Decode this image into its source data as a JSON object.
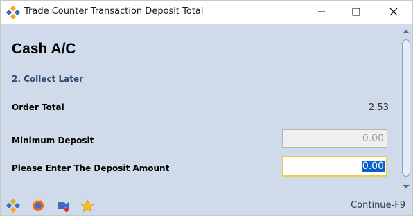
{
  "window": {
    "title": "Trade Counter Transaction Deposit Total"
  },
  "main": {
    "heading": "Cash A/C",
    "subheading": "2. Collect Later",
    "order_total_label": "Order Total",
    "order_total_value": "2.53",
    "minimum_deposit_label": "Minimum Deposit",
    "minimum_deposit_value": "0.00",
    "deposit_prompt_label": "Please Enter The Deposit Amount",
    "deposit_amount_value": "0.00"
  },
  "footer": {
    "icons": [
      "app-logo-icon",
      "browser-icon",
      "recorder-icon",
      "star-icon"
    ],
    "continue_label": "Continue-F9"
  },
  "colors": {
    "background": "#cfdbea",
    "accent": "#2e4a73",
    "selection": "#0a64c8",
    "focus_border": "#f2c94c"
  }
}
